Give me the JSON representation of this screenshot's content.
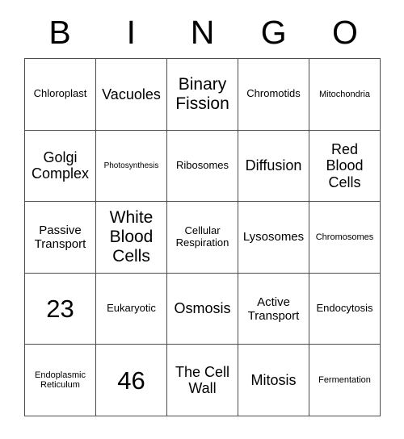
{
  "card": {
    "title": "BINGO",
    "header_letters": [
      "B",
      "I",
      "N",
      "G",
      "O"
    ],
    "columns": 5,
    "rows": 5,
    "border_color": "#4d4d4d",
    "background_color": "#ffffff",
    "text_color": "#000000"
  },
  "cells": [
    {
      "row": 1,
      "column": 1,
      "letter": "B",
      "text": "Chloroplast",
      "size": "md"
    },
    {
      "row": 1,
      "column": 2,
      "letter": "I",
      "text": "Vacuoles",
      "size": "xl"
    },
    {
      "row": 1,
      "column": 3,
      "letter": "N",
      "text": "Binary Fission",
      "size": "xxl"
    },
    {
      "row": 1,
      "column": 4,
      "letter": "G",
      "text": "Chromotids",
      "size": "md"
    },
    {
      "row": 1,
      "column": 5,
      "letter": "O",
      "text": "Mitochondria",
      "size": "sm"
    },
    {
      "row": 2,
      "column": 1,
      "letter": "B",
      "text": "Golgi Complex",
      "size": "xl"
    },
    {
      "row": 2,
      "column": 2,
      "letter": "I",
      "text": "Photosynthesis",
      "size": "xs"
    },
    {
      "row": 2,
      "column": 3,
      "letter": "N",
      "text": "Ribosomes",
      "size": "md"
    },
    {
      "row": 2,
      "column": 4,
      "letter": "G",
      "text": "Diffusion",
      "size": "xl"
    },
    {
      "row": 2,
      "column": 5,
      "letter": "O",
      "text": "Red Blood Cells",
      "size": "xl"
    },
    {
      "row": 3,
      "column": 1,
      "letter": "B",
      "text": "Passive Transport",
      "size": "lg"
    },
    {
      "row": 3,
      "column": 2,
      "letter": "I",
      "text": "White Blood Cells",
      "size": "xxl"
    },
    {
      "row": 3,
      "column": 3,
      "letter": "N",
      "text": "Cellular Respiration",
      "size": "md"
    },
    {
      "row": 3,
      "column": 4,
      "letter": "G",
      "text": "Lysosomes",
      "size": "lg"
    },
    {
      "row": 3,
      "column": 5,
      "letter": "O",
      "text": "Chromosomes",
      "size": "sm"
    },
    {
      "row": 4,
      "column": 1,
      "letter": "B",
      "text": "23",
      "size": "num"
    },
    {
      "row": 4,
      "column": 2,
      "letter": "I",
      "text": "Eukaryotic",
      "size": "md"
    },
    {
      "row": 4,
      "column": 3,
      "letter": "N",
      "text": "Osmosis",
      "size": "xl"
    },
    {
      "row": 4,
      "column": 4,
      "letter": "G",
      "text": "Active Transport",
      "size": "lg"
    },
    {
      "row": 4,
      "column": 5,
      "letter": "O",
      "text": "Endocytosis",
      "size": "md"
    },
    {
      "row": 5,
      "column": 1,
      "letter": "B",
      "text": "Endoplasmic Reticulum",
      "size": "sm"
    },
    {
      "row": 5,
      "column": 2,
      "letter": "I",
      "text": "46",
      "size": "num"
    },
    {
      "row": 5,
      "column": 3,
      "letter": "N",
      "text": "The Cell Wall",
      "size": "xl"
    },
    {
      "row": 5,
      "column": 4,
      "letter": "G",
      "text": "Mitosis",
      "size": "xl"
    },
    {
      "row": 5,
      "column": 5,
      "letter": "O",
      "text": "Fermentation",
      "size": "sm"
    }
  ]
}
